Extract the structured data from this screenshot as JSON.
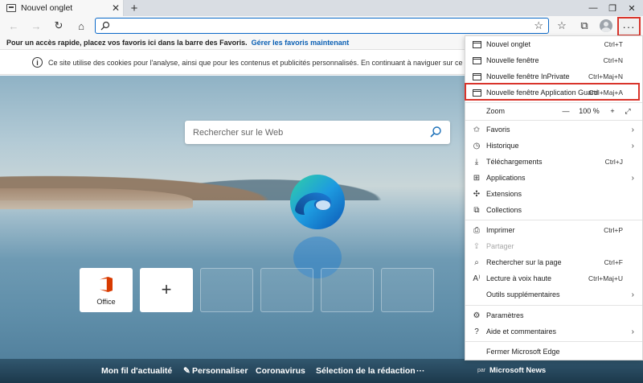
{
  "tab": {
    "title": "Nouvel onglet",
    "close": "✕"
  },
  "newtab": "+",
  "window": {
    "minimize": "—",
    "restore": "❐",
    "close": "✕"
  },
  "toolbar": {
    "back": "←",
    "forward": "→",
    "refresh": "↻",
    "home": "⌂",
    "star": "☆",
    "favorites": "☆",
    "collections": "⧉",
    "more": "···"
  },
  "favbar": {
    "text": "Pour un accès rapide, placez vos favoris ici dans la barre des Favoris.",
    "link": "Gérer les favoris maintenant"
  },
  "cookie": {
    "icon": "i",
    "text": "Ce site utilise des cookies pour l'analyse, ainsi que pour les contenus et publicités personnalisés. En continuant à naviguer sur ce site, vous accep"
  },
  "search": {
    "placeholder": "Rechercher sur le Web"
  },
  "tiles": [
    {
      "label": "Office"
    },
    {
      "label": "+"
    }
  ],
  "news": {
    "items": [
      "Mon fil d'actualité",
      "Personnaliser",
      "Coronavirus",
      "Sélection de la rédaction",
      "···"
    ],
    "by": "par",
    "brand": "Microsoft News",
    "edit_icon": "✎"
  },
  "menu": {
    "new_tab": {
      "label": "Nouvel onglet",
      "shortcut": "Ctrl+T"
    },
    "new_window": {
      "label": "Nouvelle fenêtre",
      "shortcut": "Ctrl+N"
    },
    "inprivate": {
      "label": "Nouvelle fenêtre InPrivate",
      "shortcut": "Ctrl+Maj+N"
    },
    "app_guard": {
      "label": "Nouvelle fenêtre Application Guard",
      "shortcut": "Ctrl+Maj+A"
    },
    "zoom": {
      "label": "Zoom",
      "minus": "—",
      "value": "100 %",
      "plus": "+",
      "fullscreen": "⤢"
    },
    "favorites": {
      "label": "Favoris"
    },
    "history": {
      "label": "Historique"
    },
    "downloads": {
      "label": "Téléchargements",
      "shortcut": "Ctrl+J"
    },
    "apps": {
      "label": "Applications"
    },
    "extensions": {
      "label": "Extensions"
    },
    "collections": {
      "label": "Collections"
    },
    "print": {
      "label": "Imprimer",
      "shortcut": "Ctrl+P"
    },
    "share": {
      "label": "Partager"
    },
    "find": {
      "label": "Rechercher sur la page",
      "shortcut": "Ctrl+F"
    },
    "read_aloud": {
      "label": "Lecture à voix haute",
      "shortcut": "Ctrl+Maj+U"
    },
    "more_tools": {
      "label": "Outils supplémentaires"
    },
    "settings": {
      "label": "Paramètres"
    },
    "help": {
      "label": "Aide et commentaires"
    },
    "close": {
      "label": "Fermer Microsoft Edge"
    }
  },
  "colors": {
    "accent": "#0a68c8",
    "highlight": "#d9342b",
    "office": "#d83b01"
  }
}
